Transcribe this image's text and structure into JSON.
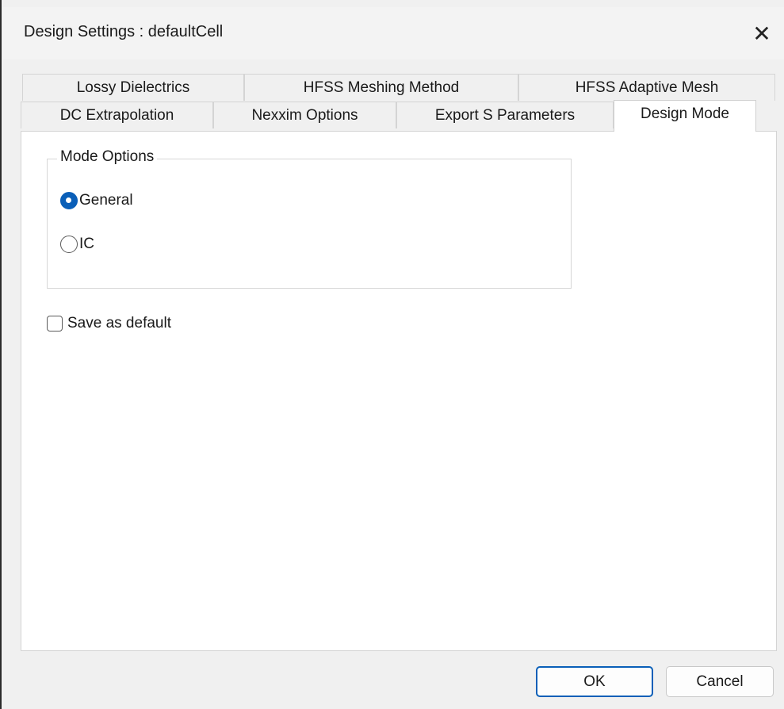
{
  "window": {
    "title": "Design Settings : defaultCell",
    "close_glyph": "✕"
  },
  "tabs": {
    "row_back": [
      {
        "label": "Lossy Dielectrics"
      },
      {
        "label": "HFSS Meshing Method"
      },
      {
        "label": "HFSS Adaptive Mesh"
      }
    ],
    "row_front": [
      {
        "label": "DC Extrapolation"
      },
      {
        "label": "Nexxim Options"
      },
      {
        "label": "Export S Parameters"
      },
      {
        "label": "Design Mode"
      }
    ],
    "active": "Design Mode"
  },
  "mode_options": {
    "legend": "Mode Options",
    "options": [
      {
        "label": "General",
        "checked": true
      },
      {
        "label": "IC",
        "checked": false
      }
    ]
  },
  "save_default": {
    "label": "Save as default",
    "checked": false
  },
  "buttons": {
    "ok": "OK",
    "cancel": "Cancel"
  },
  "colors": {
    "accent": "#0a5fb8",
    "dialog_bg": "#f0f0f0",
    "panel_bg": "#ffffff"
  },
  "icons": {
    "close": "close-icon"
  }
}
